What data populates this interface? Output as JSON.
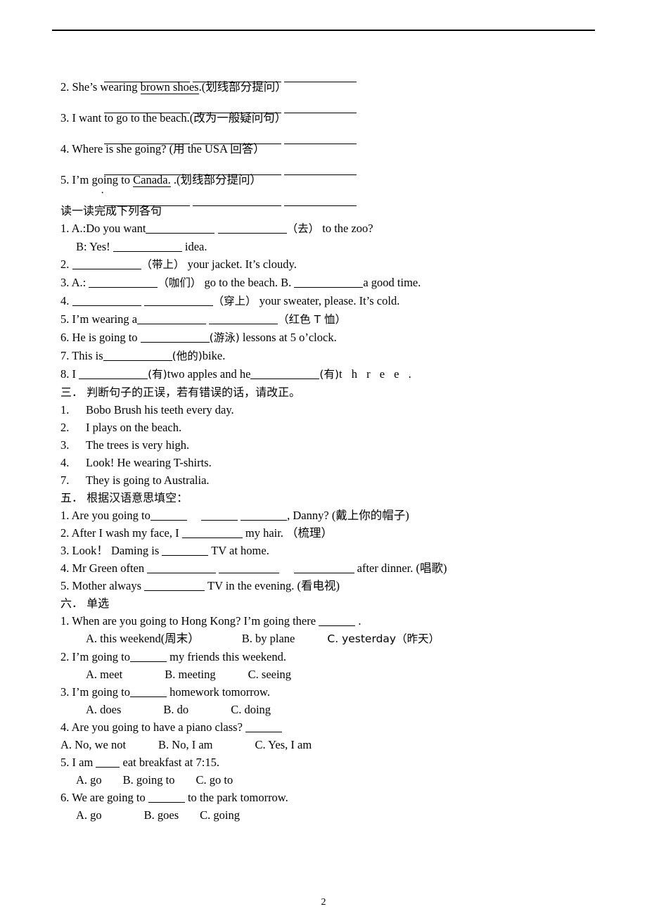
{
  "page": {
    "number": "2",
    "header_rule": true
  },
  "section_rewrite": {
    "items": [
      {
        "number": "2.",
        "text": "She’s wearing ",
        "underlined": "brown shoes",
        "tail": ".(划线部分提问）"
      },
      {
        "number": "3.",
        "text": "I want to go to the beach.",
        "underlined": "",
        "tail": "(改为一般疑问句）"
      },
      {
        "number": "4.",
        "text": "Where is she going? (用  the USA  回答）",
        "underlined": "",
        "tail": ""
      },
      {
        "number": "5.",
        "text": "I’m going to ",
        "underlined": "Canada.",
        "tail": " .(划线部分提问）"
      }
    ]
  },
  "section_two": {
    "heading": "读一读完成下列各句",
    "q1a_pre": "1. A.:Do you want",
    "q1a_hint": "（去）",
    "q1a_post": " to the zoo?",
    "q1b_pre": "B: Yes!",
    "q1b_post": " idea.",
    "q2_num": "2.",
    "q2_hint": "（带上）",
    "q2_post": " your jacket. It’s cloudy.",
    "q3_pre": "3. A.:",
    "q3_hint": "（咖们）",
    "q3_mid": " go to the beach. B.",
    "q3_post": "a good time.",
    "q4_num": "4.",
    "q4_hint": "（穿上）",
    "q4_post": " your sweater, please. It’s cold.",
    "q5_pre": "5. I’m wearing a",
    "q5_hint": "（红色 T 恤）",
    "q6_pre": "6. He is going to",
    "q6_hint": "(游泳)",
    "q6_post": " lessons at 5 o’clock.",
    "q7_pre": "7. This is",
    "q7_hint": "(他的)",
    "q7_post": "bike.",
    "q8_pre": "8. I",
    "q8_hint1": "(有)",
    "q8_mid": "two apples and he",
    "q8_hint2": "(有)",
    "q8_tail": "t h r e e ."
  },
  "section_three": {
    "heading": "三． 判断句子的正误，若有错误的话，请改正。",
    "items": [
      {
        "number": "1.",
        "text": "Bobo Brush his teeth every day."
      },
      {
        "number": "2.",
        "text": "I plays on the beach."
      },
      {
        "number": "3.",
        "text": "The trees is very high."
      },
      {
        "number": "4.",
        "text": "Look! He wearing T-shirts."
      },
      {
        "number": "7.",
        "text": "They is going to Australia."
      }
    ]
  },
  "section_five": {
    "heading": "五． 根据汉语意思填空：",
    "q1_pre": "1. Are you going to",
    "q1_post": ", Danny? (戴上你的帽子)",
    "q2_pre": "2. After I wash my face, I",
    "q2_post": " my hair. （梳理）",
    "q3_pre": "3. Look！ Daming is",
    "q3_post": " TV at home.",
    "q4_pre": "4. Mr Green often",
    "q4_post": "after dinner. (唱歌)",
    "q5_pre": "5. Mother always",
    "q5_post": "TV in the evening. (看电视)"
  },
  "section_six": {
    "heading": "六． 单选",
    "questions": [
      {
        "stem_pre": "1. When are you going to Hong Kong? I’m going there ",
        "stem_post": " .",
        "blank": "b-sm",
        "indent": "indent-1",
        "choices": [
          "A. this weekend(周末）",
          "B. by plane",
          "C. yesterday（昨天）"
        ],
        "gaps": [
          "gap-d",
          "gap-c"
        ]
      },
      {
        "stem_pre": "2. I’m going to",
        "stem_post": " my friends this weekend.",
        "blank": "b-sm",
        "indent": "indent-2",
        "choices": [
          "A. meet",
          "B. meeting",
          "C. seeing"
        ],
        "gaps": [
          "gap-d",
          "gap-c"
        ]
      },
      {
        "stem_pre": "3. I’m going to",
        "stem_post": " homework tomorrow.",
        "blank": "b-sm",
        "indent": "indent-2",
        "choices": [
          "A. does",
          "B. do",
          "C. doing"
        ],
        "gaps": [
          "gap-d",
          "gap-d"
        ]
      },
      {
        "stem_pre": "4. Are you going to have a piano class? ",
        "stem_post": "",
        "blank": "b-sm",
        "indent": "",
        "choices": [
          "A. No, we not",
          "B. No, I am",
          "C. Yes, I am"
        ],
        "gaps": [
          "gap-c",
          "gap-d"
        ]
      },
      {
        "stem_pre": "5. I am ",
        "stem_post": " eat breakfast at 7:15.",
        "blank": "b-xs",
        "indent": "indent-2",
        "choices": [
          "A. go",
          "B. going to",
          "C. go to"
        ],
        "gaps": [
          "gap-b",
          "gap-b"
        ]
      },
      {
        "stem_pre": "6. We are going to ",
        "stem_post": " to the park tomorrow.",
        "blank": "b-sm",
        "indent": "indent-2",
        "choices": [
          "A. go",
          "B. goes",
          "C. going"
        ],
        "gaps": [
          "gap-d",
          "gap-b"
        ]
      }
    ]
  }
}
